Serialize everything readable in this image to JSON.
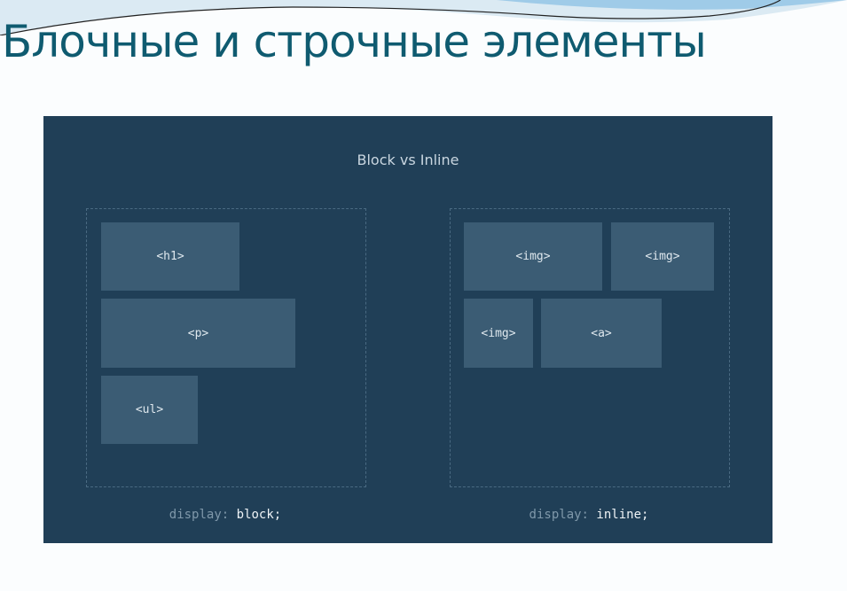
{
  "slide": {
    "title": "Блочные и строчные элементы"
  },
  "diagram": {
    "title": "Block vs Inline",
    "block": {
      "elements": [
        "<h1>",
        "<p>",
        "<ul>"
      ],
      "property": "display:",
      "value": "block;"
    },
    "inline": {
      "elements": [
        "<img>",
        "<img>",
        "<img>",
        "<a>"
      ],
      "property": "display:",
      "value": "inline;"
    }
  },
  "colors": {
    "panel": "#203f57",
    "element": "#3b5c74",
    "title": "#0f5b70"
  }
}
